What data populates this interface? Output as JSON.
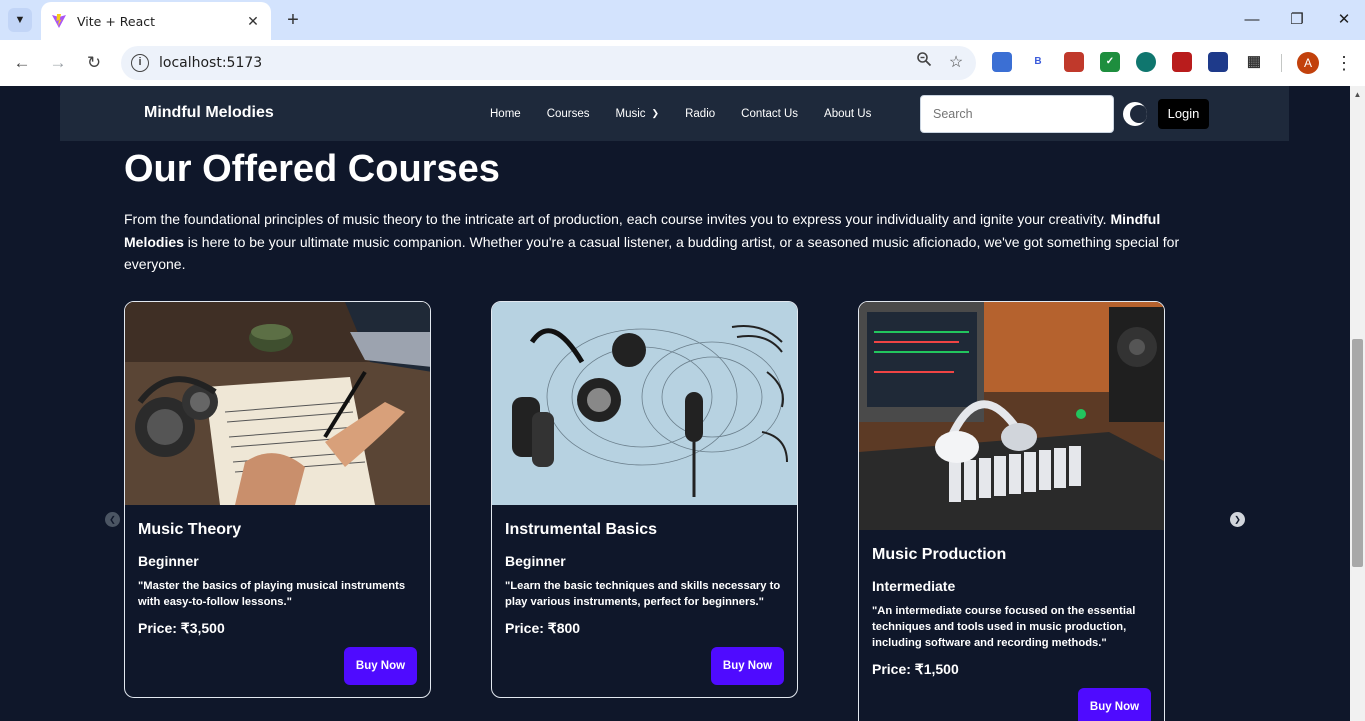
{
  "browser": {
    "tab_title": "Vite + React",
    "url": "localhost:5173",
    "profile_initial": "A",
    "extensions": [
      "B"
    ]
  },
  "site": {
    "brand": "Mindful Melodies",
    "nav": [
      "Home",
      "Courses",
      "Music",
      "Radio",
      "Contact Us",
      "About Us"
    ],
    "search_placeholder": "Search",
    "login_label": "Login"
  },
  "main": {
    "heading": "Our Offered Courses",
    "intro_part1": "From the foundational principles of music theory to the intricate art of production, each course invites you to express your individuality and ignite your creativity. ",
    "intro_brand": "Mindful Melodies",
    "intro_part2": " is here to be your ultimate music companion. Whether you're a casual listener, a budding artist, or a seasoned music aficionado, we've got something special for everyone."
  },
  "courses": [
    {
      "title": "Music Theory",
      "level": "Beginner",
      "description": "\"Master the basics of playing musical instruments with easy-to-follow lessons.\"",
      "price": "Price: ₹3,500",
      "button": "Buy Now"
    },
    {
      "title": "Instrumental Basics",
      "level": "Beginner",
      "description": "\"Learn the basic techniques and skills necessary to play various instruments, perfect for beginners.\"",
      "price": "Price: ₹800",
      "button": "Buy Now"
    },
    {
      "title": "Music Production",
      "level": "Intermediate",
      "description": "\"An intermediate course focused on the essential techniques and tools used in music production, including software and recording methods.\"",
      "price": "Price: ₹1,500",
      "button": "Buy Now"
    }
  ],
  "colors": {
    "page_bg": "#0f172a",
    "navbar_bg": "#1e293b",
    "button_accent": "#4f0bff"
  }
}
